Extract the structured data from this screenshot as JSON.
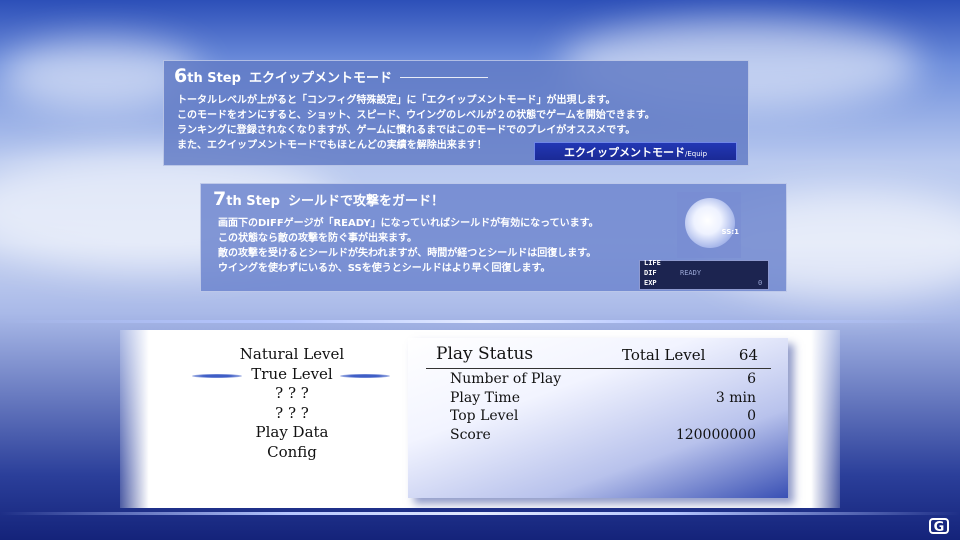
{
  "step6": {
    "number": "6",
    "step_word": "th Step",
    "heading": "エクイップメントモード",
    "lines": [
      "トータルレベルが上がると「コンフィグ特殊設定」に「エクイップメントモード」が出現します。",
      "このモードをオンにすると、ショット、スピード、ウイングのレベルが２の状態でゲームを開始できます。",
      "ランキングに登録されなくなりますが、ゲームに慣れるまではこのモードでのプレイがオススメです。",
      "また、エクイップメントモードでもほとんどの実績を解除出来ます！"
    ],
    "button_label": "エクイップメントモード",
    "button_suffix": "/Equip"
  },
  "step7": {
    "number": "7",
    "step_word": "th Step",
    "heading": "シールドで攻撃をガード！",
    "lines": [
      "画面下のDIFFゲージが「READY」になっていればシールドが有効になっています。",
      "この状態なら敵の攻撃を防ぐ事が出来ます。",
      "敵の攻撃を受けるとシールドが失われますが、時間が経つとシールドは回復します。",
      "ウイングを使わずにいるか、SSを使うとシールドはより早く回復します。"
    ],
    "orb_label": "SS:1",
    "hud": {
      "life_label": "LIFE",
      "dif_label": "DIF",
      "dif_value": "READY",
      "exp_label": "EXP",
      "exp_value": "0"
    }
  },
  "menu": {
    "items": [
      "Natural Level",
      "True Level",
      "? ? ?",
      "? ? ?",
      "Play Data",
      "Config"
    ],
    "selected_index": 1
  },
  "status": {
    "title": "Play Status",
    "total_level_label": "Total Level",
    "total_level_value": "64",
    "rows": [
      {
        "label": "Number of Play",
        "value": "6"
      },
      {
        "label": "Play Time",
        "value": "3 min"
      },
      {
        "label": "Top Level",
        "value": "0"
      },
      {
        "label": "Score",
        "value": "120000000"
      }
    ]
  },
  "watermark": "G",
  "colors": {
    "panel": "#6a83cd",
    "button": "#1f33ac",
    "selection": "#3f5ec6"
  }
}
